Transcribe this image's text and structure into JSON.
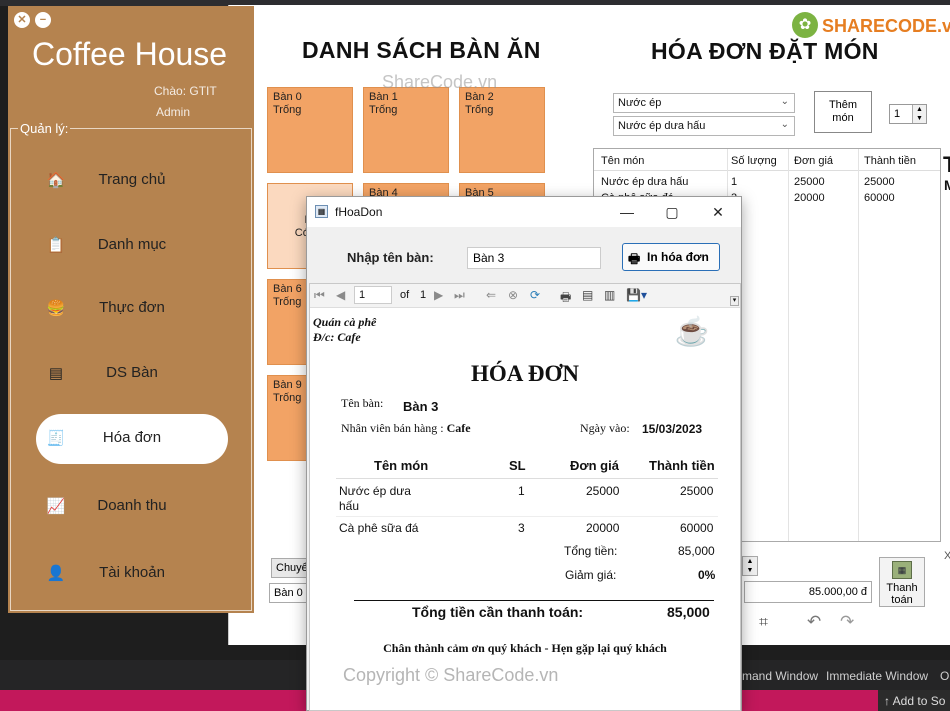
{
  "ide": {
    "bottom_tabs": [
      "mand Window",
      "Immediate Window",
      "O"
    ],
    "status_right": "Add to So"
  },
  "watermark": {
    "logo": "SHARECODE.vn",
    "center": "ShareCode.vn",
    "footer": "Copyright © ShareCode.vn"
  },
  "sidebar": {
    "app_title": "Coffee House",
    "greeting": "Chào: GTIT",
    "role": "Admin",
    "group_label": "Quản lý:",
    "items": [
      {
        "label": "Trang chủ",
        "icon": "home-icon",
        "glyph": "🏠"
      },
      {
        "label": "Danh mục",
        "icon": "category-icon",
        "glyph": "📋"
      },
      {
        "label": "Thực đơn",
        "icon": "menu-icon",
        "glyph": "🍔"
      },
      {
        "label": "DS Bàn",
        "icon": "table-icon",
        "glyph": "▤"
      },
      {
        "label": "Hóa đơn",
        "icon": "invoice-icon",
        "glyph": "🧾"
      },
      {
        "label": "Doanh thu",
        "icon": "revenue-icon",
        "glyph": "📈"
      },
      {
        "label": "Tài khoản",
        "icon": "account-icon",
        "glyph": "👤"
      }
    ],
    "active_index": 4
  },
  "main": {
    "tables_title": "DANH SÁCH BÀN ĂN",
    "order_title": "HÓA ĐƠN ĐẶT MÓN",
    "tables": [
      {
        "name": "Bàn 0",
        "status": "Trống"
      },
      {
        "name": "Bàn 1",
        "status": "Trống"
      },
      {
        "name": "Bàn 2",
        "status": "Trống"
      },
      {
        "name": "Bà",
        "status": "Có n"
      },
      {
        "name": "Bàn 4",
        "status": ""
      },
      {
        "name": "Bàn 5",
        "status": ""
      },
      {
        "name": "Bàn 6",
        "status": "Trống"
      },
      {
        "name": "Bàn 9",
        "status": "Trống"
      }
    ],
    "category_select": "Nước ép",
    "food_select": "Nước ép dưa hấu",
    "add_button": [
      "Thêm",
      "món"
    ],
    "quantity": "1",
    "grid_headers": [
      "Tên món",
      "Số lượng",
      "Đơn giá",
      "Thành tiền"
    ],
    "grid_rows": [
      [
        "Nước ép dưa hấu",
        "1",
        "25000",
        "25000"
      ],
      [
        "Cà phê sữa đá",
        "3",
        "20000",
        "60000"
      ]
    ],
    "switch_button": "Chuyể",
    "switch_select": "Bàn 0",
    "total_box": "85.000,00 đ",
    "pay_button": [
      "Thanh",
      "toán"
    ],
    "right_edge_letters": [
      "T",
      "M",
      "X"
    ]
  },
  "dialog": {
    "title": "fHoaDon",
    "table_label": "Nhập tên bàn:",
    "table_value": "Bàn 3",
    "print_button": "In hóa đơn",
    "toolbar": {
      "page": "1",
      "of_text": "of",
      "total_pages": "1"
    }
  },
  "invoice": {
    "shop": "Quán cà phê",
    "address": "Đ/c: Cafe",
    "title": "HÓA ĐƠN",
    "table_label": "Tên bàn:",
    "table_value": "Bàn 3",
    "staff_label": "Nhân viên bán hàng :",
    "staff_value": "Cafe",
    "date_label": "Ngày vào:",
    "date_value": "15/03/2023",
    "headers": [
      "Tên món",
      "SL",
      "Đơn giá",
      "Thành tiền"
    ],
    "rows": [
      {
        "name1": "Nước ép dưa",
        "name2": "hấu",
        "qty": "1",
        "price": "25000",
        "amount": "25000"
      },
      {
        "name1": "Cà phê sữa đá",
        "name2": "",
        "qty": "3",
        "price": "20000",
        "amount": "60000"
      }
    ],
    "subtotal_label": "Tổng tiền:",
    "subtotal_value": "85,000",
    "discount_label": "Giảm giá:",
    "discount_value": "0%",
    "grand_label": "Tổng tiền cần thanh toán:",
    "grand_value": "85,000",
    "thanks": "Chân thành cảm ơn quý khách - Hẹn gặp lại quý khách"
  }
}
